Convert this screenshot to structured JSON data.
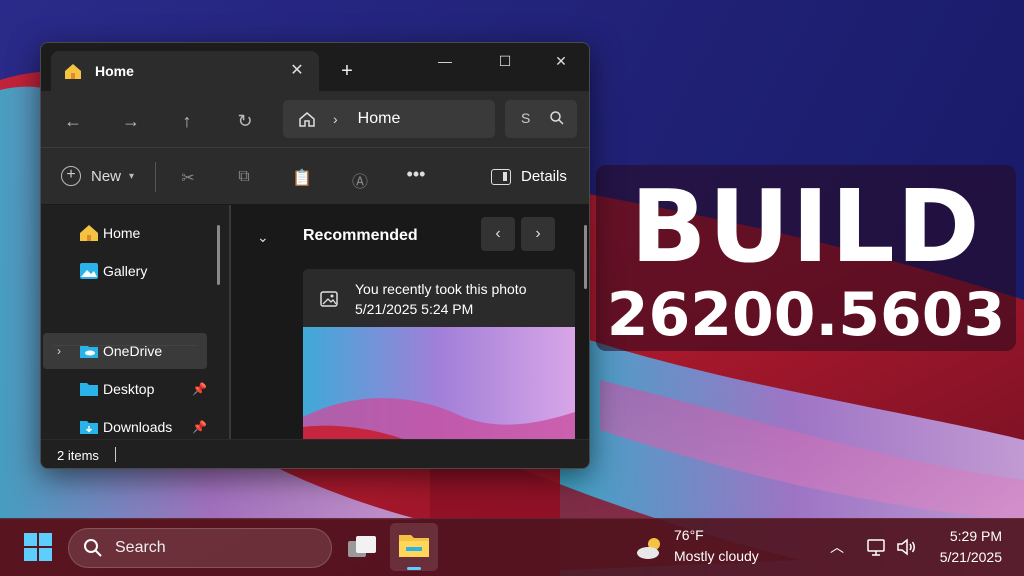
{
  "banner": {
    "line1": "BUILD",
    "line2": "26200.5603"
  },
  "explorer": {
    "tab_title": "Home",
    "address": "Home",
    "search_fragment": "S",
    "commands": {
      "new_label": "New",
      "details_label": "Details"
    },
    "sidebar": [
      {
        "label": "Home",
        "icon": "home-icon"
      },
      {
        "label": "Gallery",
        "icon": "gallery-icon"
      },
      {
        "label": "OneDrive",
        "icon": "onedrive-folder-icon",
        "selected": true
      },
      {
        "label": "Desktop",
        "icon": "desktop-folder-icon",
        "pinned": true
      },
      {
        "label": "Downloads",
        "icon": "downloads-folder-icon",
        "pinned": true
      }
    ],
    "recommended": {
      "title": "Recommended",
      "card": {
        "line1": "You recently took this photo",
        "line2": "5/21/2025 5:24 PM"
      }
    },
    "status": "2 items"
  },
  "taskbar": {
    "search_placeholder": "Search",
    "weather": {
      "temp": "76°F",
      "desc": "Mostly cloudy"
    },
    "clock": {
      "time": "5:29 PM",
      "date": "5/21/2025"
    }
  },
  "colors": {
    "accent": "#5ccfff",
    "folder_yellow": "#f5c342",
    "onedrive_blue": "#2ab3e8"
  }
}
